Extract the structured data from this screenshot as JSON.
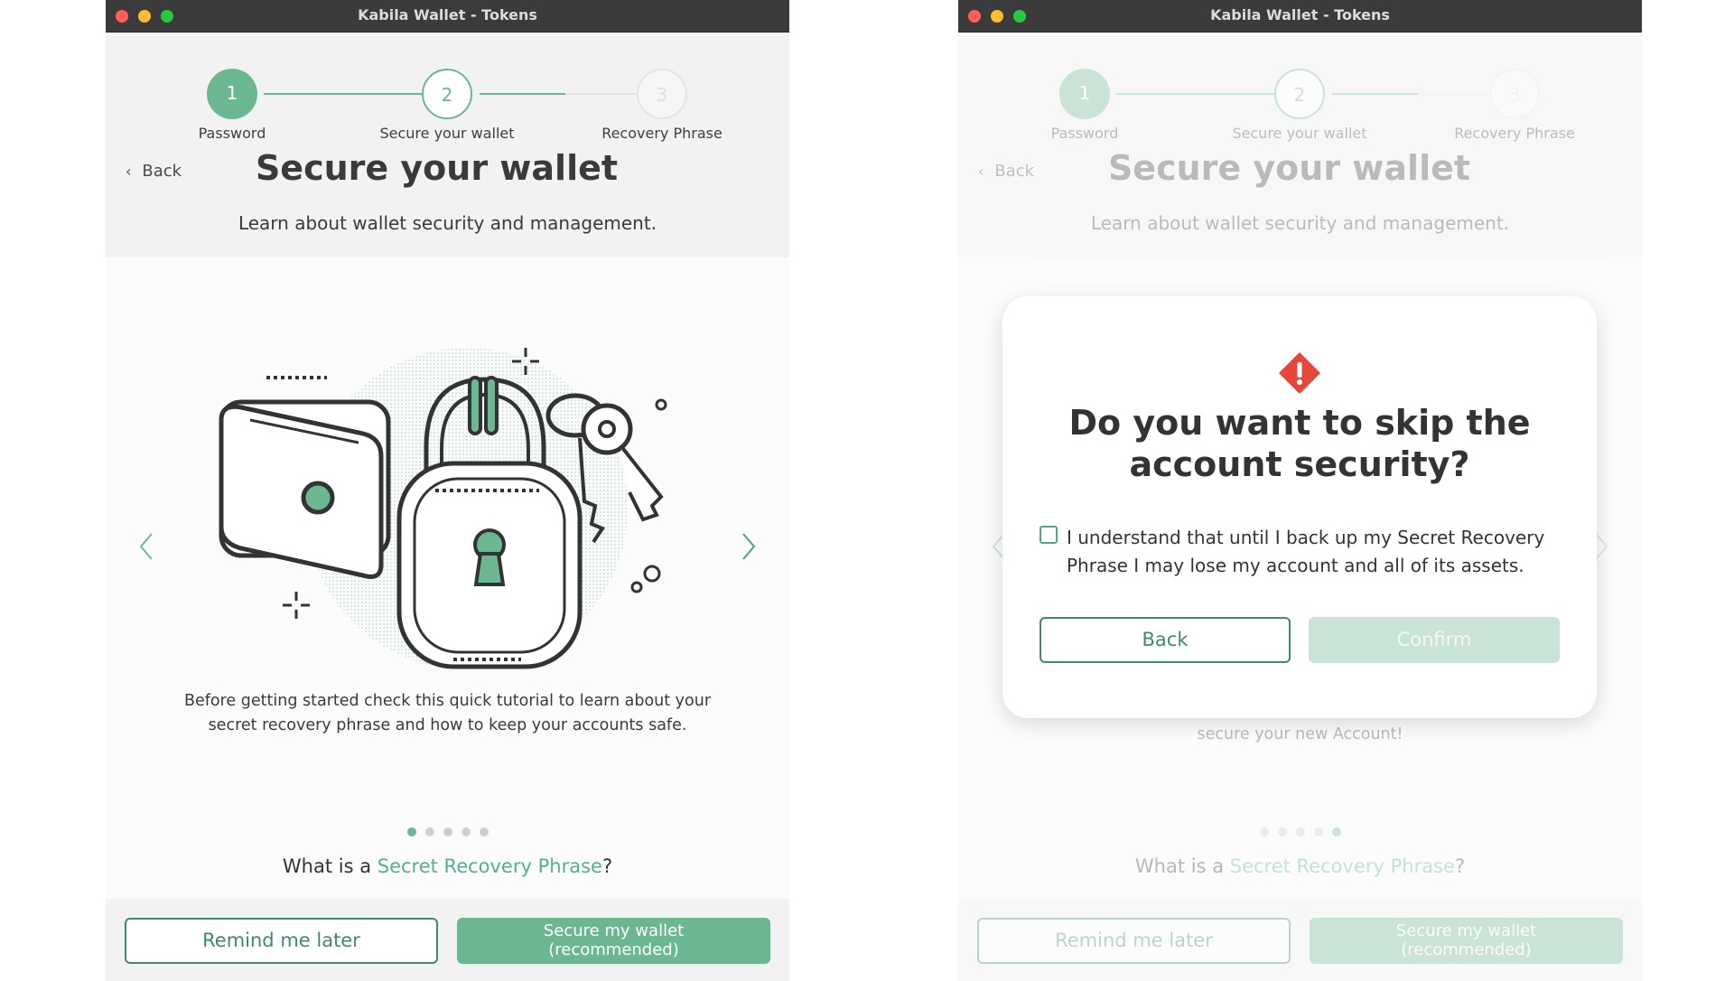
{
  "window": {
    "title": "Kabila Wallet - Tokens"
  },
  "stepper": {
    "steps": [
      {
        "number": "1",
        "label": "Password",
        "state": "done"
      },
      {
        "number": "2",
        "label": "Secure your wallet",
        "state": "current"
      },
      {
        "number": "3",
        "label": "Recovery Phrase",
        "state": "pending"
      }
    ]
  },
  "header": {
    "back_label": "Back",
    "title": "Secure your wallet",
    "subtitle": "Learn about wallet security and management."
  },
  "carousel": {
    "slide_text": "Before getting started check this quick tutorial to learn about your secret recovery phrase and how to keep your accounts safe.",
    "background_slide_text": "secure your new Account!",
    "left_page_dots": 5,
    "left_active_dot": 0,
    "right_active_dot": 4,
    "what_is_prefix": "What is a ",
    "what_is_link": "Secret Recovery Phrase",
    "what_is_suffix": "?"
  },
  "footer": {
    "remind_label": "Remind me later",
    "secure_label_line1": "Secure my wallet",
    "secure_label_line2": "(recommended)"
  },
  "modal": {
    "icon": "warning-diamond-icon",
    "title_line1": "Do you want to skip the",
    "title_line2": "account security?",
    "checkbox_checked": false,
    "checkbox_label": "I understand that until I back up my Secret Recovery Phrase I may lose my account and all of its assets.",
    "back_label": "Back",
    "confirm_label": "Confirm"
  },
  "colors": {
    "accent": "#6ab792",
    "accent_dark": "#3f8a69",
    "warning": "#e5473a",
    "titlebar": "#3b3b3b"
  }
}
